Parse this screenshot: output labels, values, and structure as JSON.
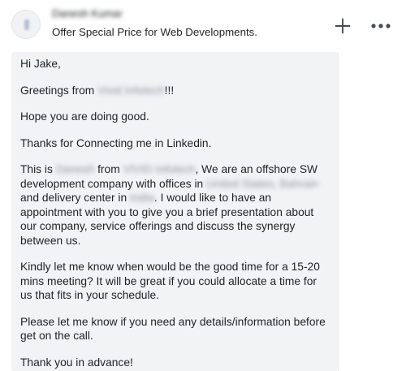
{
  "header": {
    "sender_name": "Danesh Kumar",
    "subject": "Offer Special Price for Web Developments.",
    "add_icon": "plus-icon",
    "more_icon": "more-horizontal-icon"
  },
  "message": {
    "greeting": "Hi Jake,",
    "greetings_prefix": "Greetings from ",
    "company_name": "Vivid Infotech",
    "greetings_suffix": "!!!",
    "hope": "Hope you are doing good.",
    "thanks": "Thanks for Connecting me in Linkedin.",
    "intro_this_is": "This is ",
    "intro_person": "Danesh",
    "intro_from": " from ",
    "intro_company": "VIVID Infotech",
    "intro_offshore": ", We are an offshore SW development company with offices in ",
    "intro_locations": "United States, Bahrain",
    "intro_delivery": " and delivery center in ",
    "intro_country": "India",
    "intro_rest": ". I would like to have an appointment with you to give you a brief presentation about our company, service offerings and discuss the synergy between us.",
    "kindly": "Kindly let me know when would be the good time for a 15-20 mins meeting? It will be great if you could allocate a time for us that fits in your schedule.",
    "details": "Please let me know if you need any details/information before get on the call.",
    "thank_you": "Thank you in advance!"
  },
  "colors": {
    "bubble_background": "#f2f3f5",
    "text": "#1d2226",
    "icon": "#444b52"
  }
}
